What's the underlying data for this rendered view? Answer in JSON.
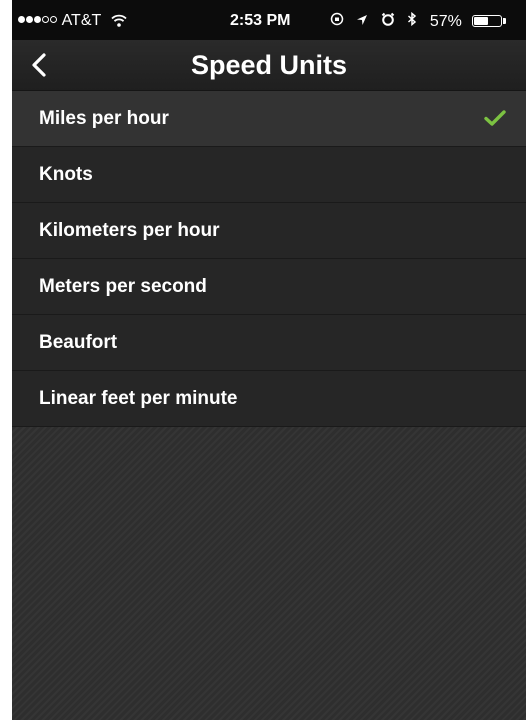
{
  "status_bar": {
    "carrier": "AT&T",
    "time": "2:53 PM",
    "battery_percent": "57%",
    "signal_bars_filled": 3,
    "signal_bars_total": 5,
    "battery_level": 0.57,
    "icons": [
      "signal-icon",
      "wifi-icon",
      "rotation-lock-icon",
      "location-arrow-icon",
      "alarm-icon",
      "bluetooth-icon",
      "battery-icon"
    ]
  },
  "nav": {
    "title": "Speed Units",
    "back_icon": "chevron-left-icon"
  },
  "units": {
    "selected_index": 0,
    "selected_icon": "checkmark-icon",
    "items": [
      {
        "label": "Miles per hour"
      },
      {
        "label": "Knots"
      },
      {
        "label": "Kilometers per hour"
      },
      {
        "label": "Meters per second"
      },
      {
        "label": "Beaufort"
      },
      {
        "label": "Linear feet per minute"
      }
    ]
  },
  "colors": {
    "checkmark": "#7cc242",
    "background": "#2b2b2b",
    "status_bar": "#0c0c0c"
  }
}
